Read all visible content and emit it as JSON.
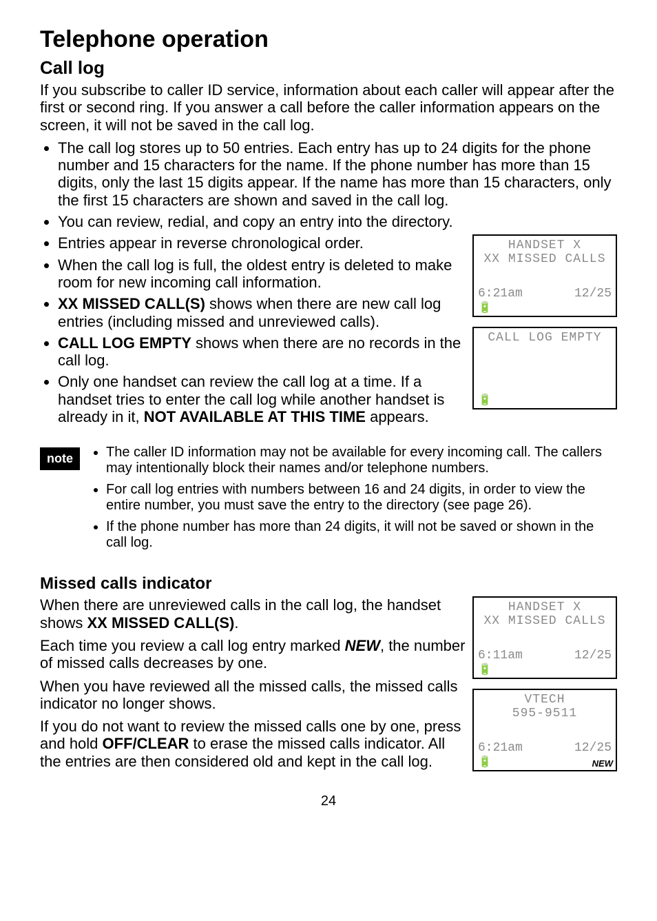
{
  "heading": "Telephone operation",
  "sub1": "Call log",
  "intro": "If you subscribe to caller ID service, information about each caller will appear after the first or second ring. If you answer a call before the caller information appears on the screen, it will not be saved in the call log.",
  "bullets1": [
    "The call log stores up to 50 entries. Each entry has up to 24 digits for the phone number and 15 characters for the name. If the phone number has more than 15 digits, only the last 15 digits appear. If the name has more than 15 characters, only the first 15 characters are shown and saved in the call log.",
    "You can review, redial, and copy an entry into the directory."
  ],
  "bullets2": [
    "Entries appear in reverse chronological order.",
    "When the call log is full, the oldest entry is deleted to make room for new incoming call information."
  ],
  "bullet_xx_missed_pre": "XX MISSED CALL(S)",
  "bullet_xx_missed_post": " shows when there are new call log entries (including missed and unreviewed calls).",
  "bullet_log_empty_pre": "CALL LOG EMPTY",
  "bullet_log_empty_post": " shows when there are no records in the call log.",
  "bullet_one_handset_pre": "Only one handset can review the call log at a time. If a handset tries to enter the call log while another handset is already in it, ",
  "bullet_one_handset_bold": "NOT AVAILABLE AT THIS TIME",
  "bullet_one_handset_post": " appears.",
  "note_label": "note",
  "notes": [
    "The caller ID information may not be available for every incoming call. The callers may intentionally block their names and/or telephone numbers.",
    "For call log entries with numbers between 16 and 24 digits, in order to view the entire number, you must save the entry to the directory (see page 26).",
    "If the phone number has more than 24 digits, it will not be saved or shown in the call log."
  ],
  "sub2": "Missed calls indicator",
  "mc_p1_pre": "When there are unreviewed calls in the call log, the handset shows ",
  "mc_p1_bold": "XX MISSED CALL(S)",
  "mc_p1_post": ".",
  "mc_p2_pre": "Each time you review a call log entry marked ",
  "mc_p2_bi": "NEW",
  "mc_p2_post": ", the number of missed calls decreases by one.",
  "mc_p3": "When you have reviewed all the missed calls, the missed calls indicator no longer shows.",
  "mc_p4_pre": "If you do not want to review the missed calls one by one, press and hold ",
  "mc_p4_bold": "OFF/",
  "mc_p4_sc": "CLEAR",
  "mc_p4_post": " to erase the missed calls indicator. All the entries are then considered old and kept in the call log.",
  "screen1": {
    "l1": "HANDSET X",
    "l2": "XX MISSED CALLS",
    "time": "6:21am",
    "date": "12/25"
  },
  "screen2": {
    "l1": "CALL LOG EMPTY"
  },
  "screen3": {
    "l1": "HANDSET X",
    "l2": "XX MISSED CALLS",
    "time": "6:11am",
    "date": "12/25"
  },
  "screen4": {
    "l1": "VTECH",
    "l2": "595-9511",
    "time": "6:21am",
    "date": "12/25",
    "new": "NEW"
  },
  "batt_icon": "🔋",
  "page_number": "24"
}
